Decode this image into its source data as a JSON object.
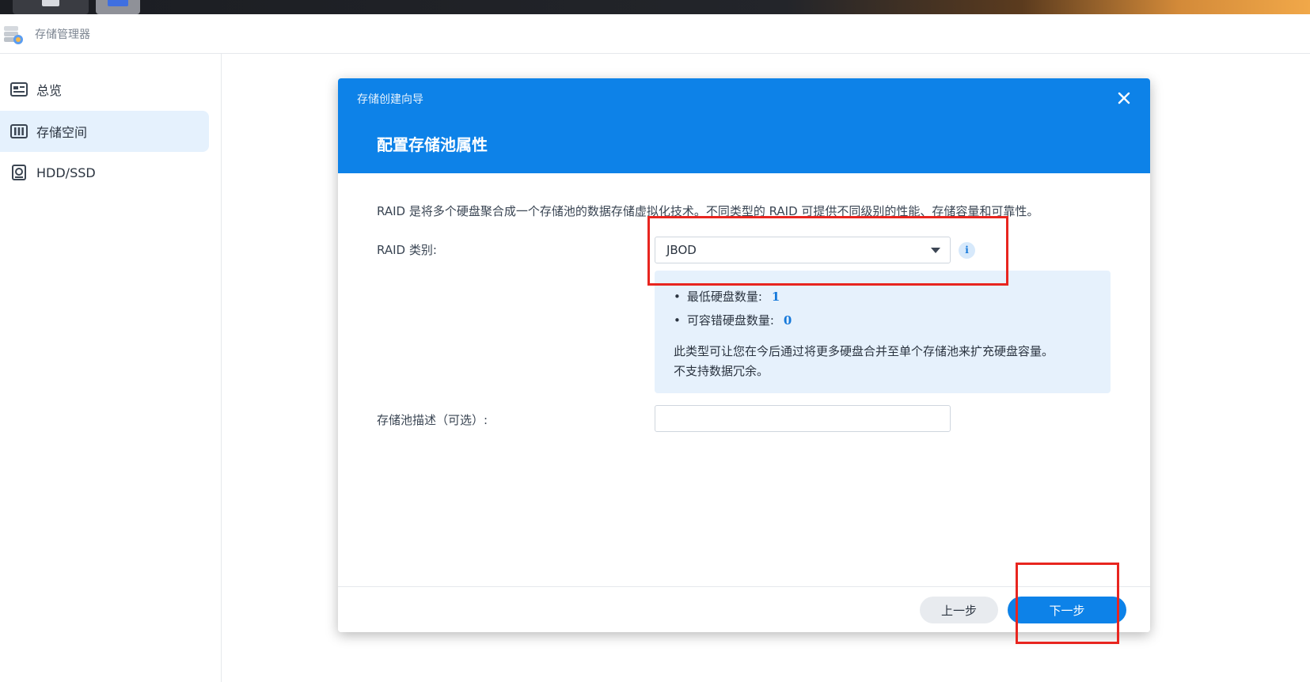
{
  "app": {
    "title": "存储管理器"
  },
  "sidebar": {
    "items": [
      {
        "label": "总览",
        "icon": "overview-card-icon",
        "active": false
      },
      {
        "label": "存储空间",
        "icon": "storage-columns-icon",
        "active": true
      },
      {
        "label": "HDD/SSD",
        "icon": "disk-icon",
        "active": false
      }
    ]
  },
  "modal": {
    "wizard_title": "存储创建向导",
    "step_title": "配置存储池属性",
    "description": "RAID 是将多个硬盘聚合成一个存储池的数据存储虚拟化技术。不同类型的 RAID 可提供不同级别的性能、存储容量和可靠性。",
    "raid_label": "RAID 类别:",
    "raid_value": "JBOD",
    "info": {
      "min_disks_label": "最低硬盘数量:",
      "min_disks_value": "1",
      "fault_tolerance_label": "可容错硬盘数量:",
      "fault_tolerance_value": "0",
      "line1": "此类型可让您在今后通过将更多硬盘合并至单个存储池来扩充硬盘容量。",
      "line2": "不支持数据冗余。"
    },
    "pool_desc_label": "存储池描述（可选）:",
    "pool_desc_value": "",
    "prev_label": "上一步",
    "next_label": "下一步"
  },
  "colors": {
    "accent": "#0d82e8",
    "annotation_red": "#e8251f",
    "info_box_bg": "#e6f1fc",
    "active_nav_bg": "#e5f1fd"
  }
}
